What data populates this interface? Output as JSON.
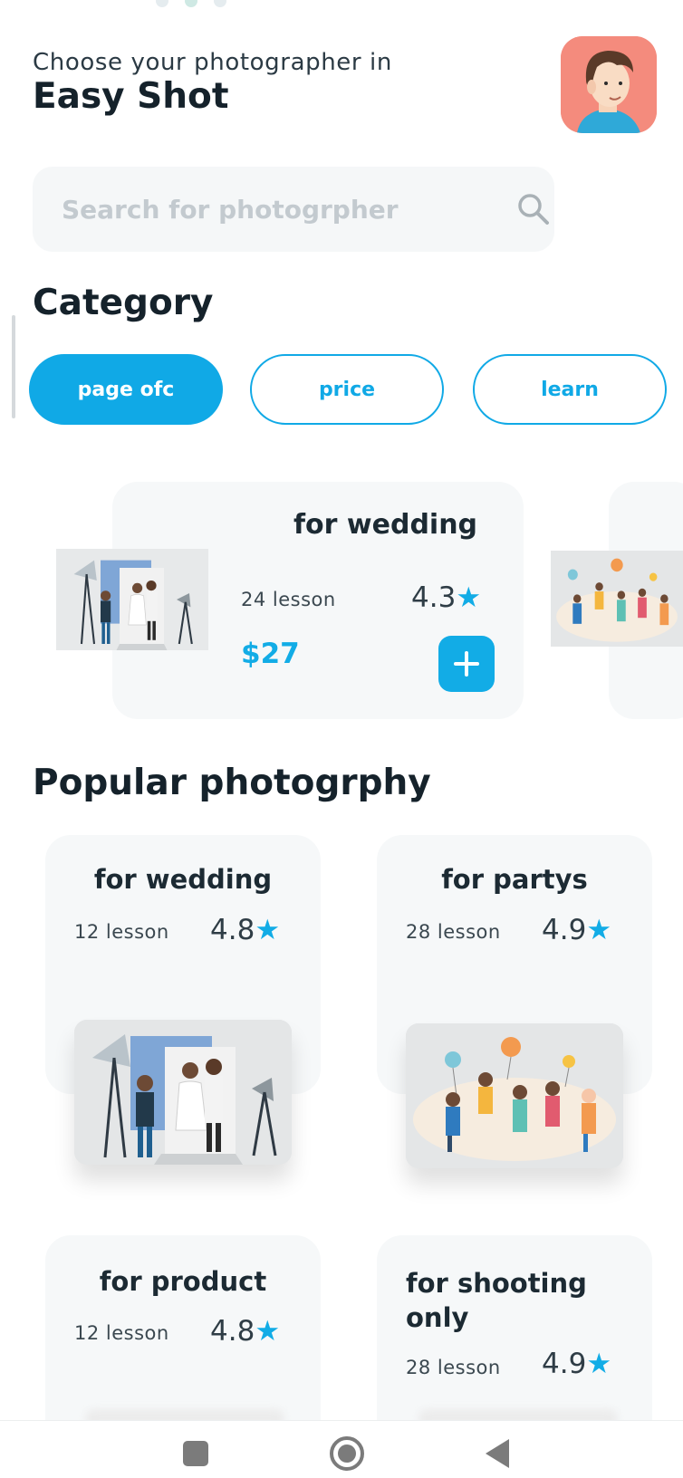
{
  "header": {
    "greeting": "Choose your photographer in",
    "app_name": "Easy Shot",
    "avatar_icon": "user-avatar-icon"
  },
  "search": {
    "placeholder": "Search for photogrpher",
    "icon": "search-icon"
  },
  "category": {
    "title": "Category",
    "chips": [
      {
        "label": "page ofc",
        "active": true
      },
      {
        "label": "price",
        "active": false
      },
      {
        "label": "learn",
        "active": false
      }
    ]
  },
  "featured": {
    "title": "for wedding",
    "lessons": "24 lesson",
    "rating": "4.3",
    "star": "★",
    "price": "$27",
    "add_icon": "plus-icon"
  },
  "popular": {
    "title": "Popular photogrphy",
    "cards": [
      {
        "title": "for wedding",
        "lessons": "12 lesson",
        "rating": "4.8",
        "star": "★"
      },
      {
        "title": "for partys",
        "lessons": "28 lesson",
        "rating": "4.9",
        "star": "★"
      },
      {
        "title": "for product",
        "lessons": "12 lesson",
        "rating": "4.8",
        "star": "★"
      },
      {
        "title": "for shooting only",
        "lessons": "28 lesson",
        "rating": "4.9",
        "star": "★"
      }
    ]
  },
  "colors": {
    "accent": "#12ace6",
    "text": "#1c2a33",
    "card_bg": "#f6f8f9",
    "avatar_bg": "#f48b7d"
  },
  "navigation": {
    "recents_icon": "square-icon",
    "home_icon": "home-circle-icon",
    "back_icon": "back-triangle-icon"
  }
}
